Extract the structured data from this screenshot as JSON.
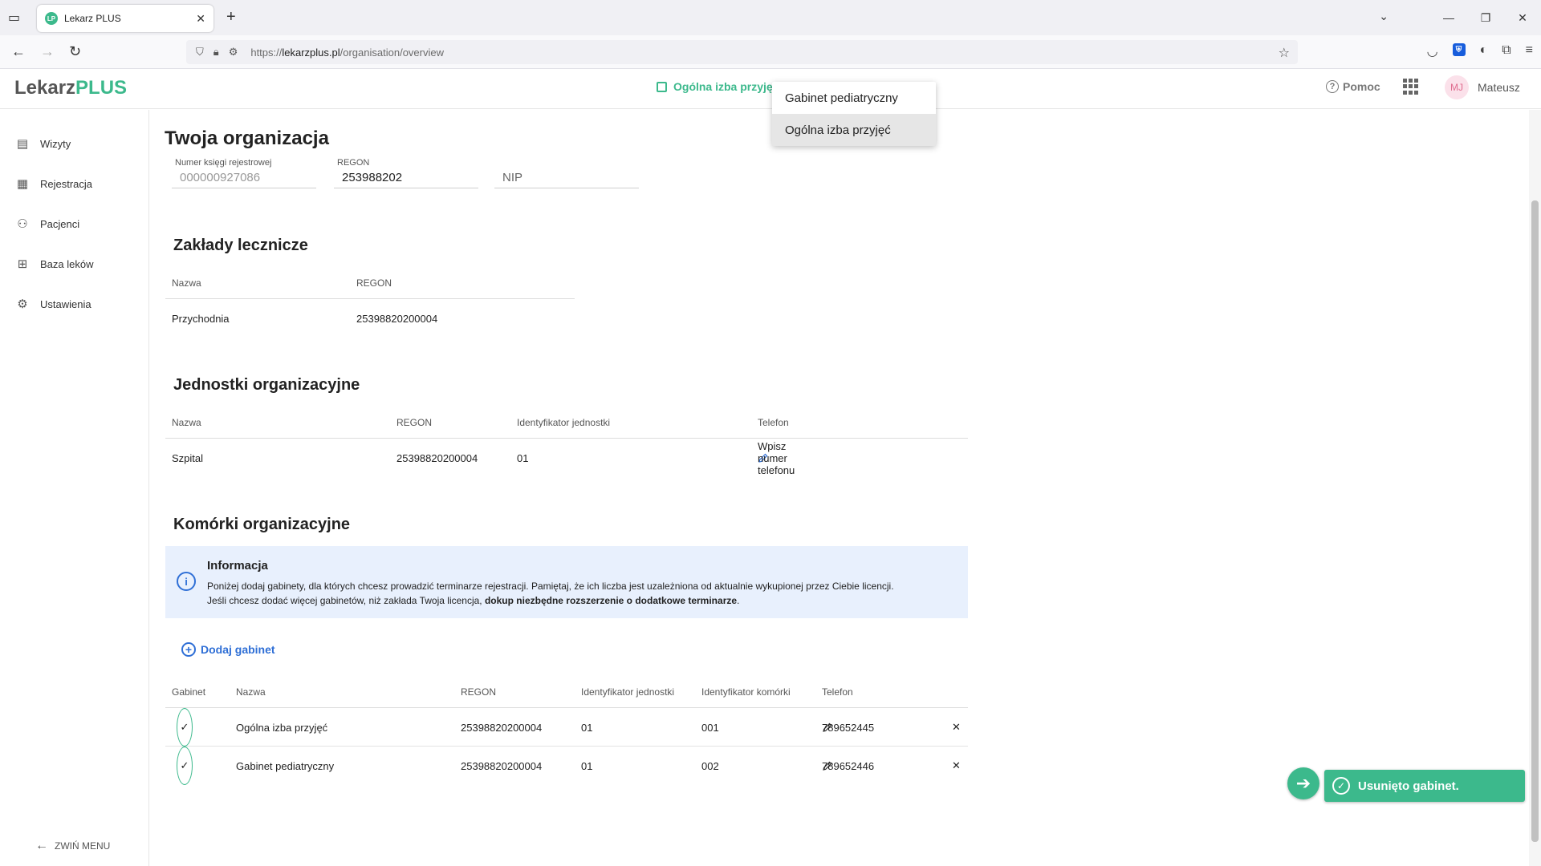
{
  "browser": {
    "tab_title": "Lekarz PLUS",
    "favicon_text": "LP",
    "url_prefix": "https://",
    "url_domain": "lekarzplus.pl",
    "url_path": "/organisation/overview"
  },
  "header": {
    "logo_main": "Lekarz",
    "logo_accent": "PLUS",
    "org_selected": "Ogólna izba przyjęć",
    "help_label": "Pomoc",
    "avatar_initials": "MJ",
    "user_name": "Mateusz"
  },
  "dropdown": {
    "options": [
      "Gabinet pediatryczny",
      "Ogólna izba przyjęć"
    ]
  },
  "sidebar": {
    "items": [
      {
        "label": "Wizyty",
        "icon": "document-icon"
      },
      {
        "label": "Rejestracja",
        "icon": "calendar-icon"
      },
      {
        "label": "Pacjenci",
        "icon": "people-icon"
      },
      {
        "label": "Baza leków",
        "icon": "medical-kit-icon"
      },
      {
        "label": "Ustawienia",
        "icon": "gear-icon"
      }
    ],
    "collapse_label": "ZWIŃ MENU"
  },
  "main": {
    "title": "Twoja organizacja",
    "fields": {
      "registry_label": "Numer księgi rejestrowej",
      "registry_value": "000000927086",
      "regon_label": "REGON",
      "regon_value": "253988202",
      "nip_placeholder": "NIP"
    },
    "zaklady": {
      "title": "Zakłady lecznicze",
      "headers": [
        "Nazwa",
        "REGON"
      ],
      "rows": [
        [
          "Przychodnia",
          "25398820200004"
        ]
      ]
    },
    "jednostki": {
      "title": "Jednostki organizacyjne",
      "headers": [
        "Nazwa",
        "REGON",
        "Identyfikator jednostki",
        "Telefon"
      ],
      "rows": [
        {
          "name": "Szpital",
          "regon": "25398820200004",
          "id": "01",
          "phone_link": "Wpisz numer telefonu"
        }
      ]
    },
    "komorki": {
      "title": "Komórki organizacyjne",
      "info_title": "Informacja",
      "info_line1": "Poniżej dodaj gabinety, dla których chcesz prowadzić terminarze rejestracji. Pamiętaj, że ich liczba jest uzależniona od aktualnie wykupionej przez Ciebie licencji.",
      "info_line2_prefix": "Jeśli chcesz dodać więcej gabinetów, niż zakłada Twoja licencja, ",
      "info_line2_bold": "dokup niezbędne rozszerzenie o dodatkowe terminarze",
      "info_line2_suffix": ".",
      "add_label": "Dodaj gabinet",
      "headers": [
        "Gabinet",
        "Nazwa",
        "REGON",
        "Identyfikator jednostki",
        "Identyfikator komórki",
        "Telefon"
      ],
      "rows": [
        {
          "name": "Ogólna izba przyjęć",
          "regon": "25398820200004",
          "unit_id": "01",
          "cell_id": "001",
          "phone": "789652445"
        },
        {
          "name": "Gabinet pediatryczny",
          "regon": "25398820200004",
          "unit_id": "01",
          "cell_id": "002",
          "phone": "789652446"
        }
      ]
    }
  },
  "toast": {
    "message": "Usunięto gabinet."
  },
  "colors": {
    "accent_green": "#3cb98c",
    "link_blue": "#2f6fd6",
    "info_bg": "#e8f0fd"
  }
}
